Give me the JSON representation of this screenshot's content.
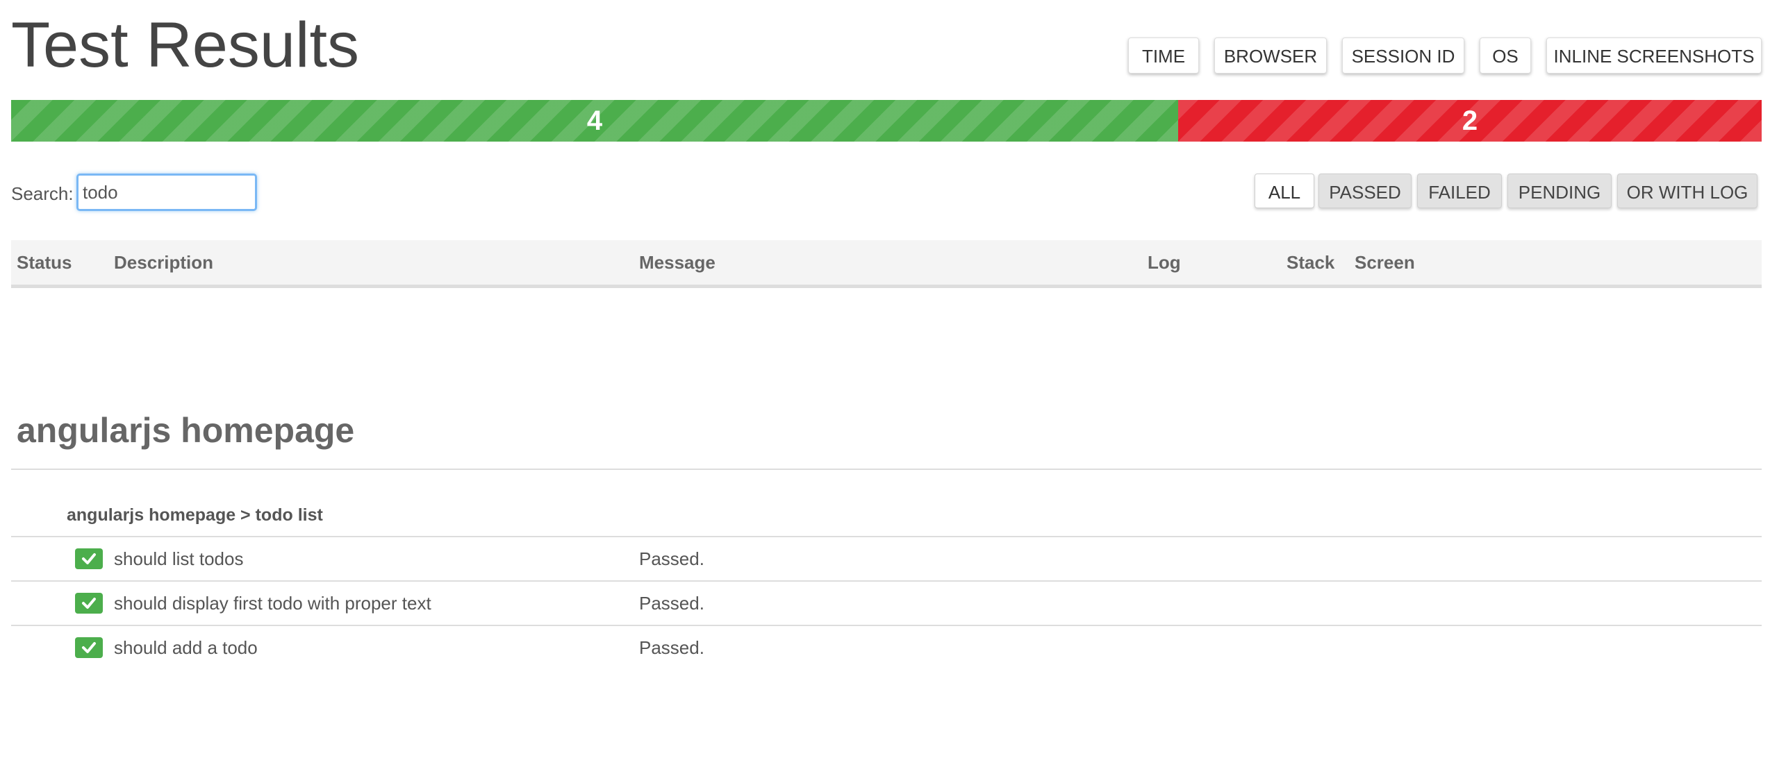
{
  "header": {
    "title": "Test Results",
    "buttons": [
      "TIME",
      "BROWSER",
      "SESSION ID",
      "OS",
      "INLINE SCREENSHOTS"
    ]
  },
  "progress": {
    "passed": 4,
    "failed": 2,
    "passed_color": "#4cae4c",
    "failed_color": "#e5202c"
  },
  "search": {
    "label": "Search:",
    "value": "todo"
  },
  "filters": {
    "active": "ALL",
    "items": [
      "ALL",
      "PASSED",
      "FAILED",
      "PENDING",
      "OR WITH LOG"
    ]
  },
  "table": {
    "columns": [
      "Status",
      "Description",
      "Message",
      "Log",
      "Stack",
      "Screen"
    ]
  },
  "suite": {
    "title": "angularjs homepage",
    "group": "angularjs homepage > todo list",
    "rows": [
      {
        "status": "passed",
        "status_icon": "check-icon",
        "description": "should list todos",
        "message": "Passed."
      },
      {
        "status": "passed",
        "status_icon": "check-icon",
        "description": "should display first todo with proper text",
        "message": "Passed."
      },
      {
        "status": "passed",
        "status_icon": "check-icon",
        "description": "should add a todo",
        "message": "Passed."
      }
    ]
  }
}
